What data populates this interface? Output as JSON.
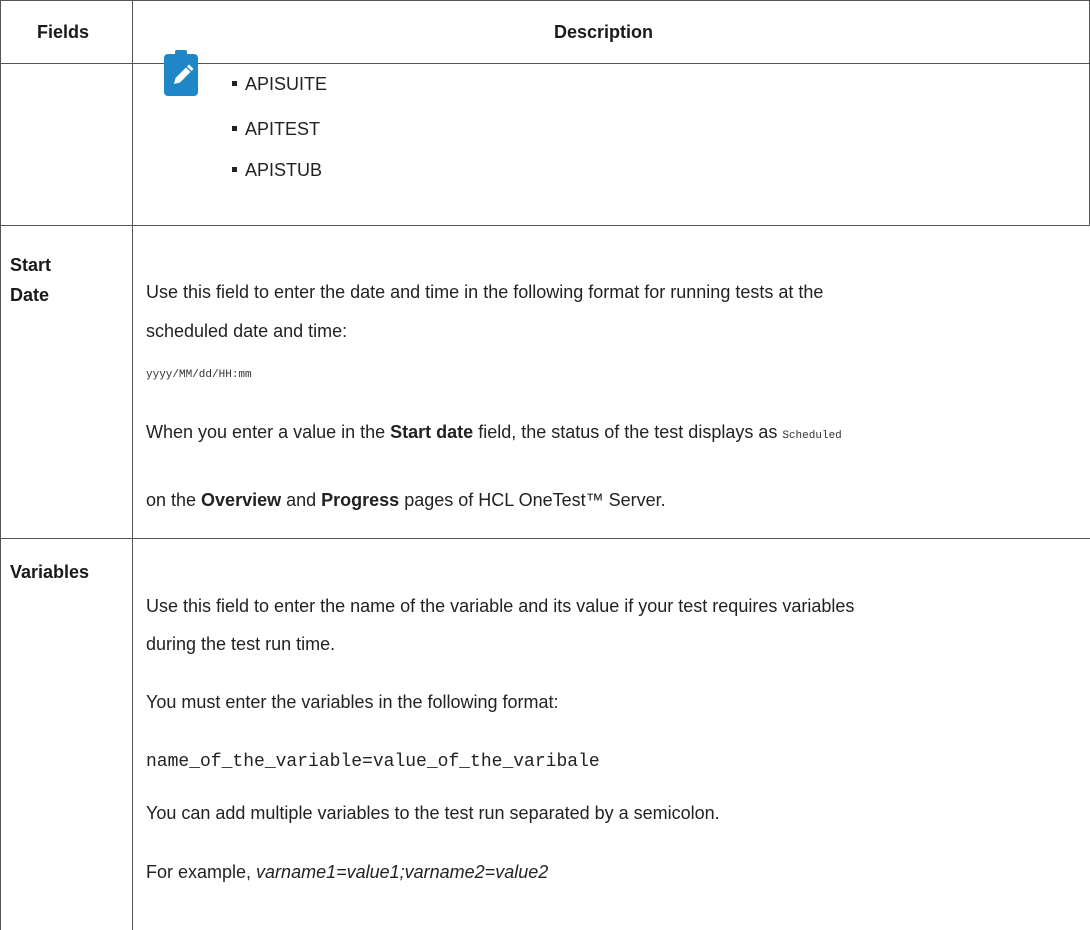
{
  "table": {
    "headers": {
      "fields": "Fields",
      "description": "Description"
    },
    "note_items": [
      "APISUITE",
      "APITEST",
      "APISTUB"
    ],
    "start_date": {
      "field_line1": "Start",
      "field_line2": "Date",
      "p1_line1": "Use this field to enter the date and time in the following format for running tests at the",
      "p1_line2": "scheduled date and time:",
      "format_code": "yyyy/MM/dd/HH:mm",
      "p2_part1": "When you enter a value in the ",
      "p2_bold1": "Start date",
      "p2_part2": " field, the status of the test displays as ",
      "p2_code": "Scheduled",
      "p3_part1": "on the ",
      "p3_bold1": "Overview",
      "p3_part2": " and ",
      "p3_bold2": "Progress",
      "p3_part3": " pages of HCL OneTest™ Server."
    },
    "variables": {
      "field": "Variables",
      "p1_line1": "Use this field to enter the name of the variable and its value if your test requires variables",
      "p1_line2": "during the test run time.",
      "p2": "You must enter the variables in the following format:",
      "format_code": "name_of_the_variable=value_of_the_varibale",
      "p3": "You can add multiple variables to the test run separated by a semicolon.",
      "p4_prefix": "For example, ",
      "p4_example": "varname1=value1;varname2=value2"
    }
  },
  "icons": {
    "note": "pencil-note-icon"
  },
  "colors": {
    "note_icon_bg": "#1f86c7",
    "border": "#555555"
  }
}
